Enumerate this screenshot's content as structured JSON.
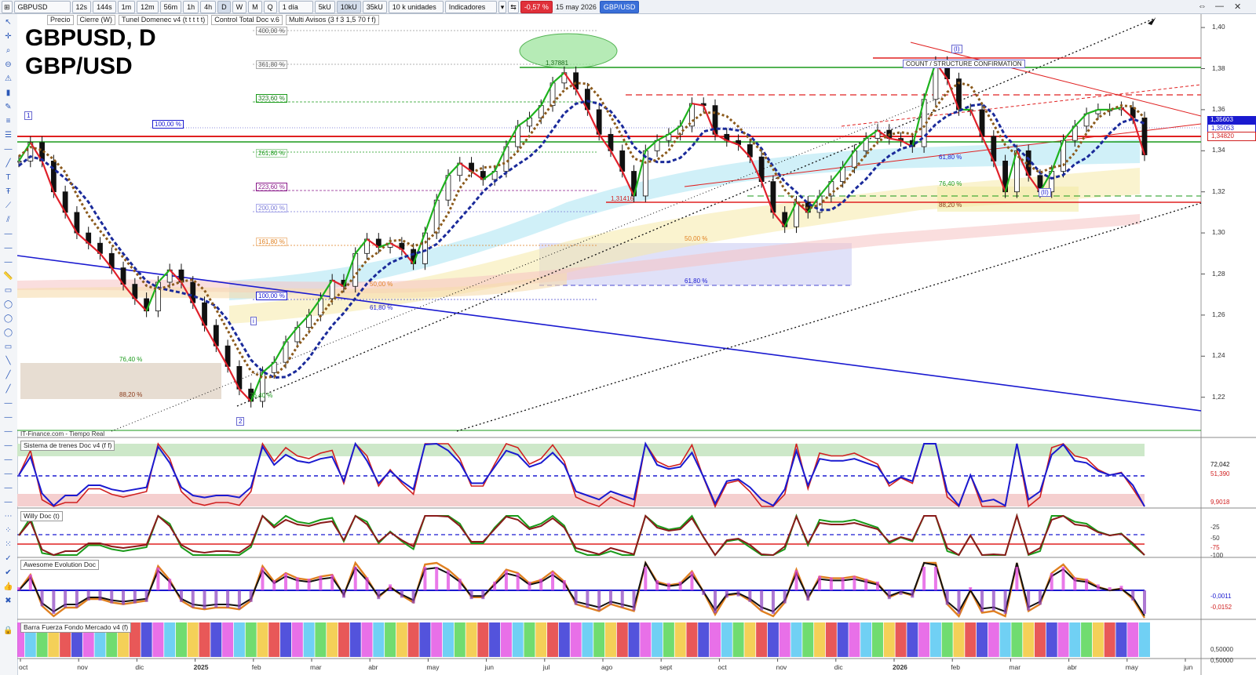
{
  "toolbar": {
    "symbol": "GBPUSD",
    "timeframes": [
      "12s",
      "144s",
      "1m",
      "12m",
      "56m",
      "1h",
      "4h",
      "D",
      "W",
      "M",
      "Q"
    ],
    "active_timeframe": "D",
    "period": "1 día",
    "volumes": [
      "5kU",
      "10kU",
      "35kU"
    ],
    "active_volume": "10kU",
    "units": "10 k unidades",
    "indicators_label": "Indicadores",
    "change": "-0,57 %",
    "date": "15 may 2026",
    "pair": "GBP/USD"
  },
  "legend": {
    "items": [
      "Precio",
      "Cierre (W)",
      "Tunel Domenec v4 (t t t t t)",
      "Control Total Doc v.6",
      "Multi Avisos (3 f 3 1,5 70 f f)"
    ]
  },
  "title_line1": "GBPUSD, D",
  "title_line2": "GBP/USD",
  "source_label": "IT-Finance.com - Tiempo Real",
  "annotations": {
    "confirm": "COUNT / STRUCTURE CONFIRMATION",
    "level_131416": "1,31416",
    "level_137881": "1,37881",
    "fib_400": "400,00 %",
    "fib_361": "361,80 %",
    "fib_323": "323,60 %",
    "fib_261": "261,80 %",
    "fib_223": "223,60 %",
    "fib_200": "200,00 %",
    "fib_161": "161,80 %",
    "fib_100a": "100,00 %",
    "fib_100b": "100,00 %",
    "fib_618": "61,80 %",
    "fib_618b": "61,80 %",
    "fib_618c": "61,80 %",
    "fib_50": "50,00 %",
    "fib_50b": "50,00 %",
    "fib_764a": "76,40 %",
    "fib_764b": "76,40 %",
    "fib_764c": "76,40 %",
    "fib_882a": "88,20 %",
    "fib_882b": "88,20 %",
    "wave_1": "1",
    "wave_2": "2",
    "wave_I": "(I)",
    "wave_II": "(II)",
    "wave_i": "i"
  },
  "indicators": {
    "trenes": "Sistema de trenes Doc v4 (f f)",
    "willy": "Willy Doc (t)",
    "awesome": "Awesome Evolution Doc",
    "barra": "Barra Fuerza Fondo Mercado v4 (f)"
  },
  "price_labels": {
    "p1": "1,35603",
    "p2": "1,35053",
    "p3": "1,34820",
    "tr1": "72,042",
    "tr2": "51,390",
    "tr3": "9,9018",
    "aw1": "-0,0011",
    "aw2": "-0,0152",
    "ba1": "0,50000",
    "ba2": "0,50000",
    "wl1": "-25",
    "wl2": "-50",
    "wl3": "-75",
    "wl4": "-100"
  },
  "colors": {
    "bg": "#ffffff",
    "up": "#1db21d",
    "down": "#e0202a",
    "trend_blue": "#1a1ad0",
    "dash_navy": "#1a2a9a",
    "brown_dots": "#8b5a1c"
  },
  "chart_data": {
    "type": "line",
    "title": "GBPUSD, D",
    "subtitle": "GBP/USD",
    "x_ticks": [
      "oct",
      "nov",
      "dic",
      "2025",
      "feb",
      "mar",
      "abr",
      "may",
      "jun",
      "jul",
      "ago",
      "sept",
      "oct",
      "nov",
      "dic",
      "2026",
      "feb",
      "mar",
      "abr",
      "may",
      "jun"
    ],
    "y_ticks": [
      1.4,
      1.38,
      1.36,
      1.34,
      1.32,
      1.3,
      1.28,
      1.26,
      1.24,
      1.22
    ],
    "ylim": [
      1.205,
      1.405
    ],
    "series": [
      {
        "values": [
          1.335,
          1.344,
          1.335,
          1.32,
          1.31,
          1.3,
          1.295,
          1.29,
          1.283,
          1.275,
          1.268,
          1.262,
          1.276,
          1.282,
          1.276,
          1.266,
          1.255,
          1.245,
          1.235,
          1.224,
          1.218,
          1.232,
          1.237,
          1.247,
          1.254,
          1.26,
          1.268,
          1.277,
          1.274,
          1.29,
          1.297,
          1.293,
          1.295,
          1.292,
          1.285,
          1.3,
          1.316,
          1.328,
          1.334,
          1.33,
          1.326,
          1.33,
          1.342,
          1.352,
          1.356,
          1.362,
          1.373,
          1.378,
          1.37,
          1.36,
          1.348,
          1.34,
          1.33,
          1.318,
          1.34,
          1.345,
          1.348,
          1.352,
          1.363,
          1.362,
          1.348,
          1.345,
          1.343,
          1.337,
          1.325,
          1.31,
          1.303,
          1.315,
          1.31,
          1.318,
          1.325,
          1.332,
          1.34,
          1.346,
          1.35,
          1.346,
          1.345,
          1.342,
          1.365,
          1.383,
          1.375,
          1.36,
          1.36,
          1.347,
          1.335,
          1.32,
          1.34,
          1.328,
          1.32,
          1.33,
          1.345,
          1.352,
          1.358,
          1.36,
          1.36,
          1.361,
          1.356,
          1.338
        ]
      }
    ]
  }
}
